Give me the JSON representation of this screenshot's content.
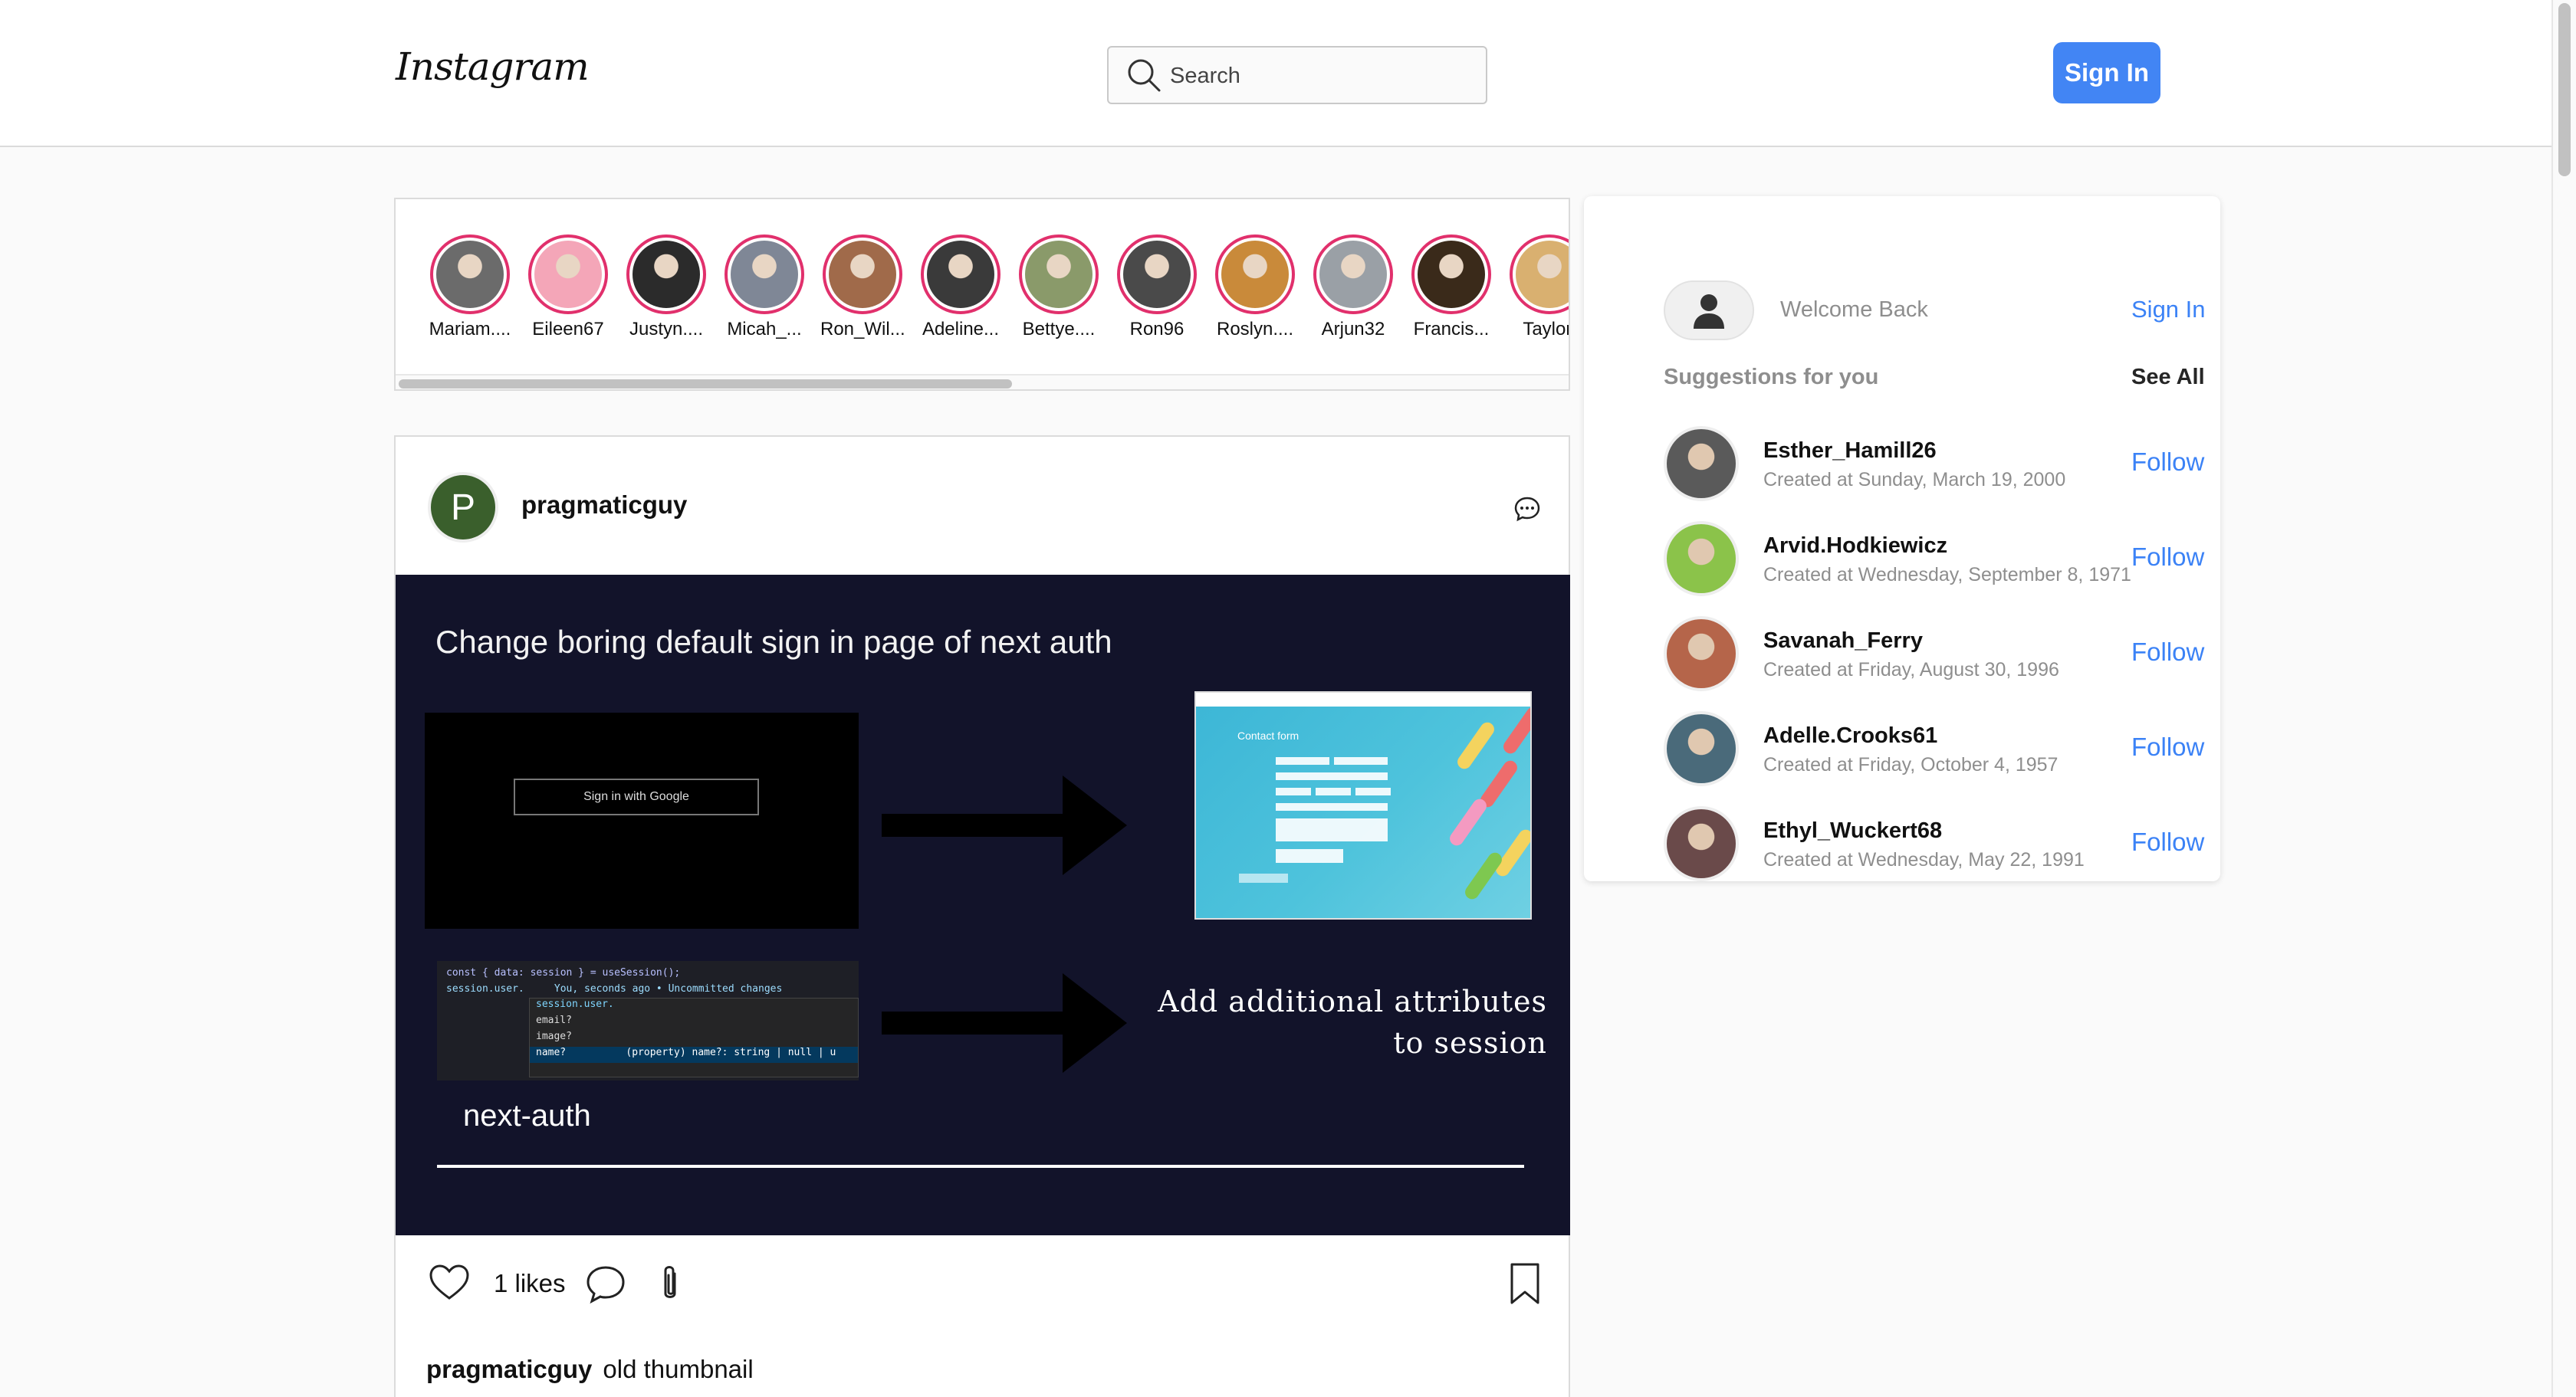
{
  "header": {
    "logo_text": "Instagram",
    "search_placeholder": "Search",
    "signin_label": "Sign In"
  },
  "stories": [
    {
      "name": "Mariam....",
      "color": "#6b6b6b"
    },
    {
      "name": "Eileen67",
      "color": "#f4a6b8"
    },
    {
      "name": "Justyn....",
      "color": "#2b2b2b"
    },
    {
      "name": "Micah_...",
      "color": "#7f8796"
    },
    {
      "name": "Ron_Wil...",
      "color": "#a06a4a"
    },
    {
      "name": "Adeline...",
      "color": "#3a3a3a"
    },
    {
      "name": "Bettye....",
      "color": "#8a9a6a"
    },
    {
      "name": "Ron96",
      "color": "#4a4a4a"
    },
    {
      "name": "Roslyn....",
      "color": "#c98a3a"
    },
    {
      "name": "Arjun32",
      "color": "#9aa0a6"
    },
    {
      "name": "Francis...",
      "color": "#3a2a1a"
    },
    {
      "name": "Taylor.",
      "color": "#d9b070"
    }
  ],
  "post": {
    "avatar_letter": "P",
    "username": "pragmaticguy",
    "image": {
      "title": "Change boring default sign in page of next auth",
      "google_button": "Sign in with Google",
      "form_title": "Contact form",
      "code_line_1": "const { data: session } = useSession();",
      "code_line_2": "session.user.     You, seconds ago • Uncommitted changes",
      "code_pop_1": "session.user.",
      "code_pop_2": "email?",
      "code_pop_3": "image?",
      "code_pop_4": "name?          (property) name?: string | null | u",
      "side_line_1": "Add additional attributes",
      "side_line_2": "to session",
      "footer_label": "next-auth"
    },
    "likes": "1 likes",
    "caption_user": "pragmaticguy",
    "caption_text": "old thumbnail"
  },
  "sidebar": {
    "welcome": "Welcome Back",
    "signin_label": "Sign In",
    "suggestions_title": "Suggestions for you",
    "see_all": "See All",
    "follow_label": "Follow",
    "suggestions": [
      {
        "name": "Esther_Hamill26",
        "date": "Created at Sunday, March 19, 2000",
        "color": "#5a5a5a"
      },
      {
        "name": "Arvid.Hodkiewicz",
        "date": "Created at Wednesday, September 8, 1971",
        "color": "#8bc34a"
      },
      {
        "name": "Savanah_Ferry",
        "date": "Created at Friday, August 30, 1996",
        "color": "#b5654a"
      },
      {
        "name": "Adelle.Crooks61",
        "date": "Created at Friday, October 4, 1957",
        "color": "#4a6a7a"
      },
      {
        "name": "Ethyl_Wuckert68",
        "date": "Created at Wednesday, May 22, 1991",
        "color": "#6a4a4a"
      }
    ]
  }
}
